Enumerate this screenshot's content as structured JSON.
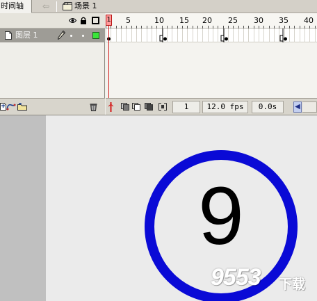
{
  "tabs": {
    "timeline_label": "时间轴"
  },
  "header": {
    "scene_label": "场景 1"
  },
  "layer": {
    "name": "图层 1"
  },
  "ruler": {
    "labels": [
      "5",
      "10",
      "15",
      "20",
      "25",
      "30",
      "35",
      "40"
    ]
  },
  "playhead": {
    "current_frame_label": "1"
  },
  "status": {
    "current_frame": "1",
    "frame_rate": "12.0 fps",
    "elapsed_time": "0.0s"
  },
  "stage": {
    "countdown_digit": "9"
  },
  "watermark": {
    "text": "9553",
    "suffix": "下载"
  },
  "colors": {
    "ring": "#0a0ad6",
    "layer_color": "#39e539",
    "playhead": "#d31a1a",
    "selected_layer_row": "#9e9c96"
  },
  "icons": [
    "back-arrow-icon",
    "scene-icon",
    "eye-icon",
    "lock-icon",
    "outline-icon",
    "layer-page-icon",
    "pencil-icon",
    "add-layer-icon",
    "add-guide-icon",
    "add-folder-icon",
    "trash-icon",
    "center-frame-icon",
    "onion-skin-icon",
    "onion-outline-icon",
    "edit-multiple-icon",
    "onion-markers-icon"
  ]
}
